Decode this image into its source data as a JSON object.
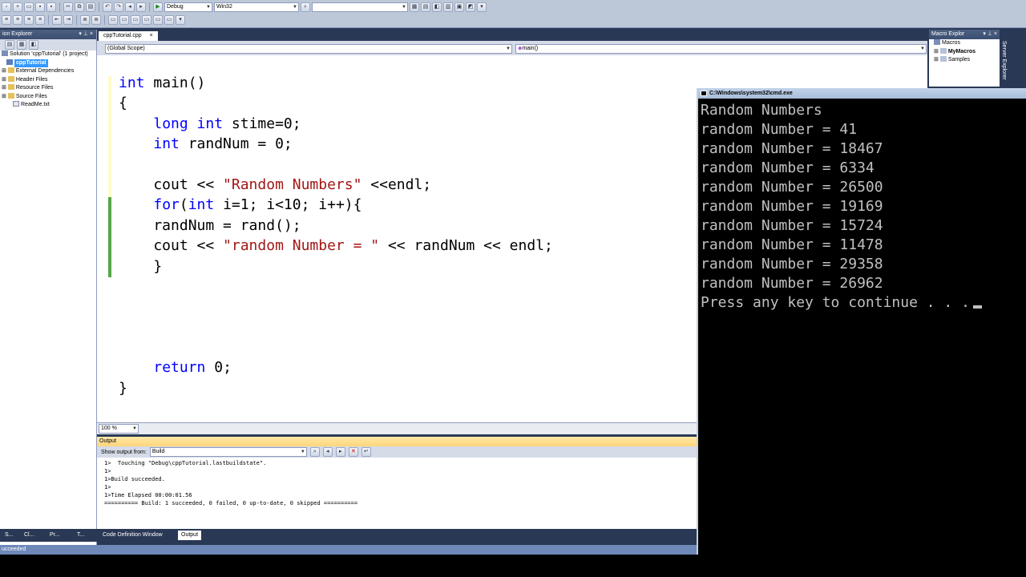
{
  "toolbar": {
    "config": "Debug",
    "platform": "Win32",
    "find_box": ""
  },
  "solution_explorer": {
    "title": "ion Explorer",
    "pin": "▾ ⊥ ×",
    "root": "Solution 'cppTutorial' (1 project)",
    "project": "cppTutorial",
    "items": [
      "External Dependencies",
      "Header Files",
      "Resource Files",
      "Source Files",
      "ReadMe.txt"
    ]
  },
  "editor": {
    "tab": "cppTutorial.cpp",
    "scope": "(Global Scope)",
    "member": "main()",
    "zoom": "100 %",
    "lines": [
      [
        [
          "kw",
          "int"
        ],
        [
          "t",
          " main()"
        ]
      ],
      [
        [
          "t",
          "{"
        ]
      ],
      [
        [
          "t",
          "    "
        ],
        [
          "kw",
          "long int"
        ],
        [
          "t",
          " stime=0;"
        ]
      ],
      [
        [
          "t",
          "    "
        ],
        [
          "kw",
          "int"
        ],
        [
          "t",
          " randNum = 0;"
        ]
      ],
      [
        [
          "t",
          ""
        ]
      ],
      [
        [
          "t",
          "    cout << "
        ],
        [
          "str",
          "\"Random Numbers\""
        ],
        [
          "t",
          " <<endl;"
        ]
      ],
      [
        [
          "t",
          "    "
        ],
        [
          "kw",
          "for"
        ],
        [
          "t",
          "("
        ],
        [
          "kw",
          "int"
        ],
        [
          "t",
          " i=1; i<10; i++){"
        ]
      ],
      [
        [
          "t",
          "    randNum = rand();"
        ]
      ],
      [
        [
          "t",
          "    cout << "
        ],
        [
          "str",
          "\"random Number = \""
        ],
        [
          "t",
          " << randNum << endl;"
        ]
      ],
      [
        [
          "t",
          "    }"
        ]
      ],
      [
        [
          "t",
          ""
        ]
      ],
      [
        [
          "t",
          ""
        ]
      ],
      [
        [
          "t",
          ""
        ]
      ],
      [
        [
          "t",
          ""
        ]
      ],
      [
        [
          "t",
          "    "
        ],
        [
          "kw",
          "return"
        ],
        [
          "t",
          " 0;"
        ]
      ],
      [
        [
          "t",
          "}"
        ]
      ]
    ]
  },
  "output": {
    "title": "Output",
    "show_from_label": "Show output from:",
    "source": "Build",
    "lines": [
      "1>  Touching \"Debug\\cppTutorial.lastbuildstate\".",
      "1>",
      "1>Build succeeded.",
      "1>",
      "1>Time Elapsed 00:00:01.56",
      "========== Build: 1 succeeded, 0 failed, 0 up-to-date, 0 skipped =========="
    ]
  },
  "bottom_tabs": {
    "left": [
      "S...",
      "Cl...",
      "Pr...",
      "T..."
    ],
    "code_def": "Code Definition Window",
    "output": "Output"
  },
  "status": "ucceeded",
  "macro_explorer": {
    "title": "Macro Explor",
    "items": [
      "Macros",
      "MyMacros",
      "Samples"
    ],
    "side_label": "Server Explorer"
  },
  "console": {
    "title": "C:\\Windows\\system32\\cmd.exe",
    "lines": [
      "Random Numbers",
      "random Number = 41",
      "random Number = 18467",
      "random Number = 6334",
      "random Number = 26500",
      "random Number = 19169",
      "random Number = 15724",
      "random Number = 11478",
      "random Number = 29358",
      "random Number = 26962",
      "Press any key to continue . . ."
    ]
  }
}
